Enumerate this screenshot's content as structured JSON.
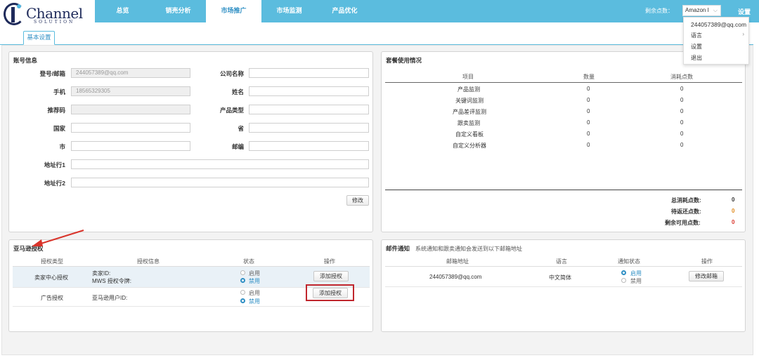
{
  "logo": {
    "brand": "Channel",
    "sub": "SOLUTION"
  },
  "nav": [
    {
      "label": "总览",
      "active": false
    },
    {
      "label": "销売分析",
      "active": false
    },
    {
      "label": "市场推广",
      "active": true
    },
    {
      "label": "市场监测",
      "active": false
    },
    {
      "label": "产品优化",
      "active": false
    }
  ],
  "header": {
    "points_label": "剩余点数：",
    "store_select": "Amazon I",
    "settings": "设置"
  },
  "dropdown": {
    "email": "244057389@qq.com",
    "items": [
      "语言",
      "设置",
      "退出"
    ]
  },
  "tab": {
    "label": "基本设置"
  },
  "account": {
    "title": "账号信息",
    "fields": {
      "email_label": "登号/邮箱",
      "email_value": "244057389@qq.com",
      "phone_label": "手机",
      "phone_value": "18565329305",
      "referral_label": "推荐码",
      "country_label": "国家",
      "city_label": "市",
      "address1_label": "地址行1",
      "address2_label": "地址行2",
      "company_label": "公司名称",
      "name_label": "姓名",
      "product_type_label": "产品类型",
      "province_label": "省",
      "zip_label": "邮编"
    },
    "edit_button": "修改"
  },
  "package": {
    "title": "套餐使用情况",
    "headers": [
      "项目",
      "数量",
      "消耗点数"
    ],
    "rows": [
      {
        "item": "产品监测",
        "qty": "0",
        "points": "0"
      },
      {
        "item": "关键词监测",
        "qty": "0",
        "points": "0"
      },
      {
        "item": "产品差评监测",
        "qty": "0",
        "points": "0"
      },
      {
        "item": "跟卖监测",
        "qty": "0",
        "points": "0"
      },
      {
        "item": "自定义看板",
        "qty": "0",
        "points": "0"
      },
      {
        "item": "自定义分析器",
        "qty": "0",
        "points": "0"
      }
    ],
    "summary": [
      {
        "label": "总消耗点数:",
        "value": "0",
        "color": "#333333"
      },
      {
        "label": "待返还点数:",
        "value": "0",
        "color": "#e08a1e"
      },
      {
        "label": "剩余可用点数:",
        "value": "0",
        "color": "#d9342b"
      }
    ]
  },
  "amazon": {
    "title": "亚马逊授权",
    "headers": [
      "授权类型",
      "授权信息",
      "状态",
      "操作"
    ],
    "rows": [
      {
        "type": "卖家中心授权",
        "info1": "卖家ID:",
        "info2": "MWS 授权令牌:",
        "enable": "启用",
        "disable": "禁用",
        "action": "添加授权"
      },
      {
        "type": "广告授权",
        "info1": "亚马逊用户ID:",
        "info2": "",
        "enable": "启用",
        "disable": "禁用",
        "action": "添加授权"
      }
    ]
  },
  "mail": {
    "title": "邮件通知",
    "desc": "系统通知和跟卖通知会发送到以下邮箱地址",
    "headers": [
      "邮箱地址",
      "语言",
      "通知状态",
      "操作"
    ],
    "row": {
      "email": "244057389@qq.com",
      "lang": "中文简体",
      "enable": "启用",
      "disable": "禁用",
      "action": "修改邮箱"
    }
  },
  "colors": {
    "accent": "#5bbcde",
    "highlight": "#c0262d",
    "link": "#2f8fc4"
  }
}
